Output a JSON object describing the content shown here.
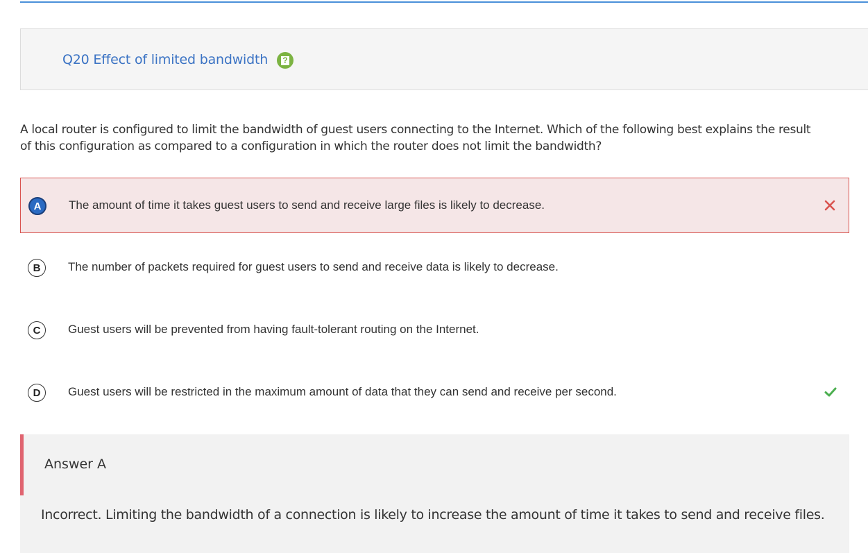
{
  "question": {
    "title": "Q20 Effect of limited bandwidth",
    "help_icon": "help-question-icon",
    "stem": "A local router is configured to limit the bandwidth of guest users connecting to the Internet. Which of the following best explains the result of this configuration as compared to a configuration in which the router does not limit the bandwidth?"
  },
  "choices": [
    {
      "letter": "A",
      "text": "The amount of time it takes guest users to send and receive large files is likely to decrease.",
      "state": "selected-incorrect",
      "mark_icon": "close-icon"
    },
    {
      "letter": "B",
      "text": "The number of packets required for guest users to send and receive data is likely to decrease.",
      "state": "unselected"
    },
    {
      "letter": "C",
      "text": "Guest users will be prevented from having fault-tolerant routing on the Internet.",
      "state": "unselected"
    },
    {
      "letter": "D",
      "text": "Guest users will be restricted in the maximum amount of data that they can send and receive per second.",
      "state": "correct",
      "mark_icon": "check-icon"
    }
  ],
  "explanation": {
    "label": "Answer A",
    "text": "Incorrect. Limiting the bandwidth of a connection is likely to increase the amount of time it takes to send and receive files."
  },
  "colors": {
    "accent": "#3b73c4",
    "incorrect": "#d9534f",
    "correct": "#4caf50",
    "help_badge": "#7cb342"
  }
}
